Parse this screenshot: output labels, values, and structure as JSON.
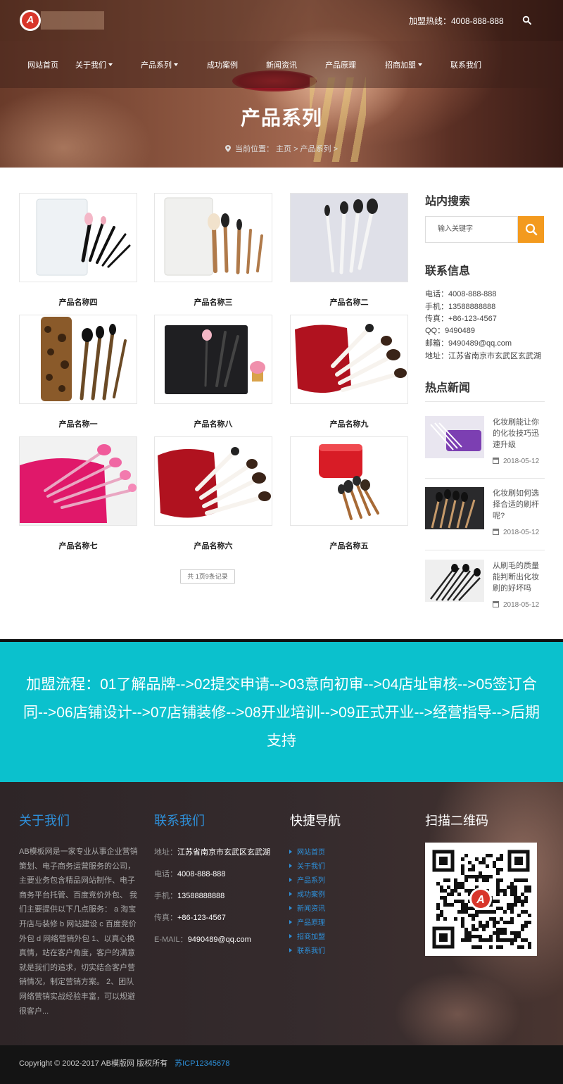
{
  "header": {
    "logo_letter": "A",
    "hotline": "加盟热线：4008-888-888"
  },
  "nav": [
    {
      "label": "网站首页",
      "dropdown": false
    },
    {
      "label": "关于我们",
      "dropdown": true
    },
    {
      "label": "产品系列",
      "dropdown": true
    },
    {
      "label": "成功案例",
      "dropdown": false
    },
    {
      "label": "新闻资讯",
      "dropdown": false
    },
    {
      "label": "产品原理",
      "dropdown": false
    },
    {
      "label": "招商加盟",
      "dropdown": true
    },
    {
      "label": "联系我们",
      "dropdown": false
    }
  ],
  "hero": {
    "title": "产品系列",
    "breadcrumb": "当前位置： 主页 > 产品系列 >"
  },
  "products": [
    {
      "name": "产品名称四",
      "bg": "#f6f8fa"
    },
    {
      "name": "产品名称三",
      "bg": "#f7f7f5"
    },
    {
      "name": "产品名称二",
      "bg": "#dfe0e8"
    },
    {
      "name": "产品名称一",
      "bg": "#ffffff"
    },
    {
      "name": "产品名称八",
      "bg": "#ffffff"
    },
    {
      "name": "产品名称九",
      "bg": "#ffffff"
    },
    {
      "name": "产品名称七",
      "bg": "#f2f2f2"
    },
    {
      "name": "产品名称六",
      "bg": "#ffffff"
    },
    {
      "name": "产品名称五",
      "bg": "#ffffff"
    }
  ],
  "pager": "共 1页9条记录",
  "sidebar": {
    "search_title": "站内搜索",
    "search_placeholder": "输入关键字",
    "contact_title": "联系信息",
    "contact_lines": [
      "电话：4008-888-888",
      "手机：13588888888",
      "传真：+86-123-4567",
      "QQ：9490489",
      "邮箱：9490489@qq.com",
      "地址：江苏省南京市玄武区玄武湖"
    ],
    "news_title": "热点新闻",
    "news": [
      {
        "title": "化妆刷能让你的化妆技巧迅速升级",
        "date": "2018-05-12"
      },
      {
        "title": "化妆刷如何选择合适的刷杆呢?",
        "date": "2018-05-12"
      },
      {
        "title": "从刷毛的质量能判断出化妆刷的好坏吗",
        "date": "2018-05-12"
      }
    ]
  },
  "banner": {
    "text": "加盟流程：01了解品牌-->02提交申请-->03意向初审-->04店址审核-->05签订合同-->06店铺设计-->07店铺装修-->08开业培训-->09正式开业-->经营指导-->后期支持"
  },
  "footer": {
    "about_title": "关于我们",
    "about_text": "AB模板网是一家专业从事企业营销策划、电子商务运营服务的公司，主要业务包含精品网站制作、电子商务平台托管、百度竞价外包、 我们主要提供以下几点服务： a 淘宝开店与装修 b 网站建设 c 百度竞价外包 d 网络营销外包 1、以真心换真情，站在客户角度，客户的满意就是我们的追求，切实结合客户营销情况，制定营销方案。 2、团队网络营销实战经验丰富，可以规避很客户...",
    "contact_title": "联系我们",
    "contact": [
      {
        "label": "地址：",
        "value": "江苏省南京市玄武区玄武湖"
      },
      {
        "label": "电话：",
        "value": "4008-888-888"
      },
      {
        "label": "手机：",
        "value": "13588888888"
      },
      {
        "label": "传真：",
        "value": "+86-123-4567"
      },
      {
        "label": "E-MAIL：",
        "value": "9490489@qq.com"
      }
    ],
    "quicknav_title": "快捷导航",
    "quicknav": [
      "网站首页",
      "关于我们",
      "产品系列",
      "成功案例",
      "新闻资讯",
      "产品原理",
      "招商加盟",
      "联系我们"
    ],
    "qr_title": "扫描二维码"
  },
  "copyright": {
    "text": "Copyright © 2002-2017 AB模版网 版权所有",
    "icp": "苏ICP12345678"
  },
  "colors": {
    "accent_orange": "#f39a1e",
    "banner_cyan": "#0bc1cd",
    "footer_blue": "#2e8fd8"
  }
}
